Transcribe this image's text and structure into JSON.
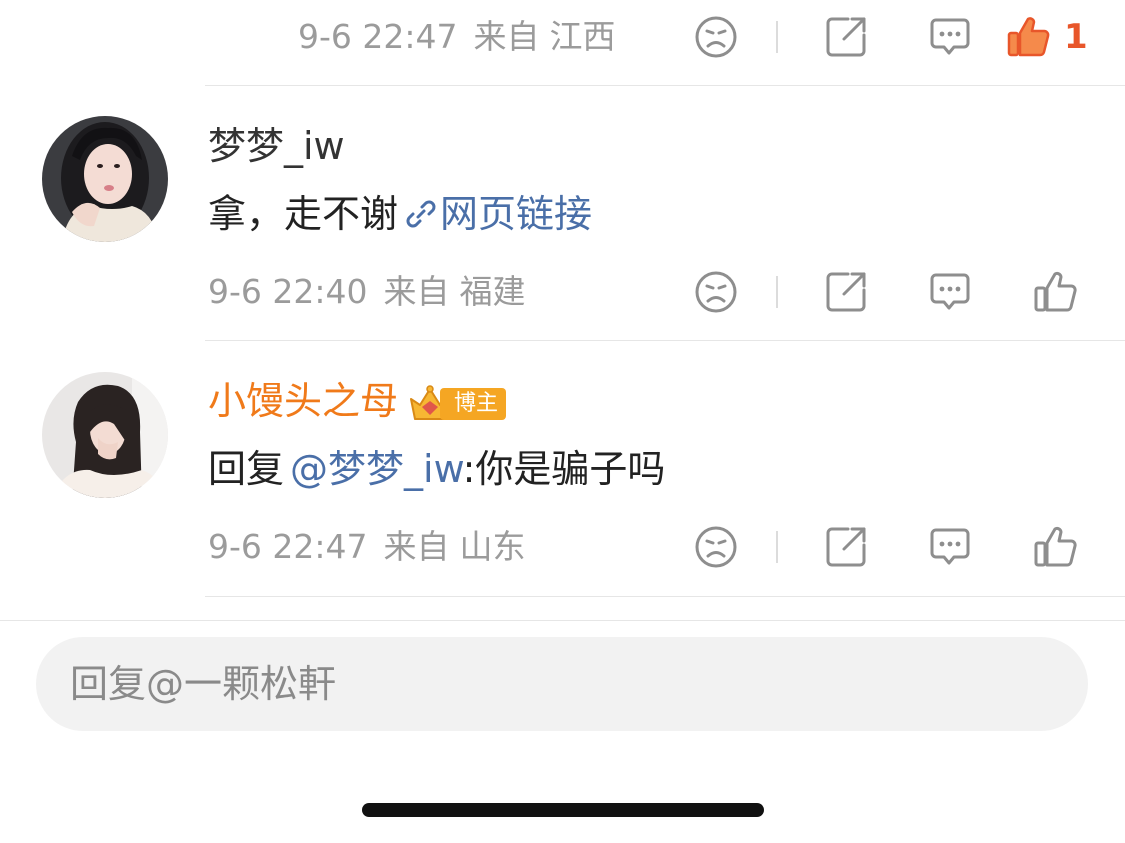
{
  "top_comment": {
    "timestamp": "9-6 22:47",
    "location_prefix": "来自",
    "location": "江西",
    "like_count": "1"
  },
  "comments": [
    {
      "username": "梦梦_iw",
      "text": "拿，走不谢",
      "link_text": "网页链接",
      "timestamp": "9-6 22:40",
      "location_prefix": "来自",
      "location": "福建"
    },
    {
      "username": "小馒头之母",
      "badge_label": "博主",
      "reply_prefix": "回复",
      "mention": "@梦梦_iw",
      "text": ":你是骗子吗",
      "timestamp": "9-6 22:47",
      "location_prefix": "来自",
      "location": "山东"
    }
  ],
  "input": {
    "placeholder": "回复@一颗松軒"
  },
  "icons": {
    "dislike": "sad-face-icon",
    "share": "share-icon",
    "reply": "comment-bubble-icon",
    "like": "thumbs-up-icon",
    "link": "link-icon",
    "badge": "crown-icon"
  },
  "colors": {
    "accent_orange": "#f07a1a",
    "mention_blue": "#4a6fa8",
    "like_active": "#e8562a",
    "meta_gray": "#9b9b9b"
  }
}
